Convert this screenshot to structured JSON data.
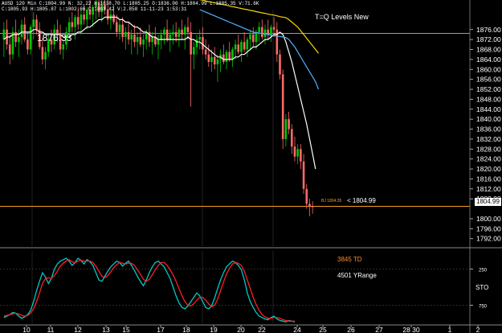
{
  "header": {
    "info_line_1": "AUSD 120 Min  C:1804.99  N:  32.22 H:1838.70  L:1805.25  O:1836.00  H:1804.99  L:1805.35  V:71.6K",
    "info_line_2": "C:1805.93  H:1805.87  L:1802.66  C:1803.42  V:2.858  11-11-23  1:53:31"
  },
  "labels": {
    "study_title": "T=Q Levels New",
    "price_annotation": "1876.33",
    "current_price_marker": "< 1804.99",
    "current_price_tag": "BJ 1804.35",
    "price_axis_box": "1804.99",
    "td_label": "3845 TD",
    "yrange_label": "4501 YRange",
    "sto_label": "STO"
  },
  "colors": {
    "background": "#000000",
    "grid": "#3a3a3a",
    "candle_up": "#00c800",
    "candle_down": "#ff6a6a",
    "ma_white": "#ffffff",
    "ma_blue": "#4fb2ff",
    "ma_yellow": "#f5d800",
    "level_orange": "#f0a020",
    "sto_k": "#00c8c8",
    "sto_d": "#ff2020",
    "td_label": "#ff8c28"
  },
  "chart_data": [
    {
      "type": "candlestick",
      "instrument": "AUSD",
      "y_axis": {
        "ticks": [
          1876,
          1872,
          1868,
          1864,
          1860,
          1856,
          1852,
          1848,
          1844,
          1840,
          1836,
          1832,
          1828,
          1824,
          1820,
          1816,
          1812,
          1808,
          1800,
          1796,
          1792
        ],
        "ylim": [
          1789,
          1884
        ]
      },
      "x_axis": {
        "tick_labels": [
          "10",
          "11",
          "12",
          "13",
          "15",
          "17",
          "18",
          "19",
          "20",
          "22",
          "24",
          "25",
          "26",
          "27",
          "28 30",
          "1",
          "2"
        ]
      },
      "horizontal_levels": [
        1874.5,
        1804.99
      ],
      "ohlc": [
        [
          1872,
          1879,
          1865,
          1876
        ],
        [
          1876,
          1880,
          1868,
          1870
        ],
        [
          1870,
          1874,
          1862,
          1866
        ],
        [
          1866,
          1877,
          1864,
          1875
        ],
        [
          1875,
          1880,
          1869,
          1871
        ],
        [
          1871,
          1876,
          1865,
          1873
        ],
        [
          1873,
          1880,
          1870,
          1878
        ],
        [
          1878,
          1881,
          1871,
          1872
        ],
        [
          1872,
          1875,
          1866,
          1868
        ],
        [
          1868,
          1878,
          1866,
          1877
        ],
        [
          1877,
          1883,
          1872,
          1880
        ],
        [
          1880,
          1882,
          1874,
          1876
        ],
        [
          1876,
          1879,
          1868,
          1869
        ],
        [
          1869,
          1873,
          1862,
          1864
        ],
        [
          1864,
          1869,
          1860,
          1867
        ],
        [
          1867,
          1874,
          1865,
          1872
        ],
        [
          1872,
          1876,
          1867,
          1870
        ],
        [
          1870,
          1878,
          1868,
          1876
        ],
        [
          1876,
          1880,
          1871,
          1874
        ],
        [
          1874,
          1878,
          1866,
          1868
        ],
        [
          1868,
          1872,
          1864,
          1870
        ],
        [
          1870,
          1877,
          1868,
          1875
        ],
        [
          1875,
          1881,
          1872,
          1879
        ],
        [
          1879,
          1883,
          1875,
          1877
        ],
        [
          1877,
          1882,
          1872,
          1881
        ],
        [
          1881,
          1885,
          1876,
          1878
        ],
        [
          1878,
          1884,
          1874,
          1882
        ],
        [
          1882,
          1886,
          1878,
          1880
        ],
        [
          1880,
          1885,
          1876,
          1884
        ],
        [
          1884,
          1888,
          1880,
          1882
        ],
        [
          1882,
          1886,
          1877,
          1885
        ],
        [
          1885,
          1890,
          1880,
          1887
        ],
        [
          1887,
          1890,
          1881,
          1883
        ],
        [
          1883,
          1888,
          1879,
          1886
        ],
        [
          1886,
          1890,
          1882,
          1884
        ],
        [
          1884,
          1888,
          1878,
          1880
        ],
        [
          1880,
          1884,
          1876,
          1882
        ],
        [
          1882,
          1886,
          1878,
          1879
        ],
        [
          1879,
          1882,
          1873,
          1875
        ],
        [
          1875,
          1880,
          1872,
          1878
        ],
        [
          1878,
          1881,
          1871,
          1873
        ],
        [
          1873,
          1877,
          1868,
          1875
        ],
        [
          1875,
          1879,
          1870,
          1872
        ],
        [
          1872,
          1876,
          1866,
          1874
        ],
        [
          1874,
          1878,
          1869,
          1871
        ],
        [
          1871,
          1875,
          1866,
          1873
        ],
        [
          1873,
          1877,
          1869,
          1870
        ],
        [
          1870,
          1874,
          1865,
          1872
        ],
        [
          1872,
          1876,
          1868,
          1875
        ],
        [
          1875,
          1878,
          1869,
          1871
        ],
        [
          1871,
          1875,
          1866,
          1873
        ],
        [
          1873,
          1877,
          1869,
          1870
        ],
        [
          1870,
          1874,
          1864,
          1872
        ],
        [
          1872,
          1876,
          1868,
          1874
        ],
        [
          1874,
          1877,
          1870,
          1876
        ],
        [
          1876,
          1880,
          1871,
          1872
        ],
        [
          1872,
          1876,
          1867,
          1874
        ],
        [
          1874,
          1878,
          1870,
          1875
        ],
        [
          1875,
          1879,
          1871,
          1873
        ],
        [
          1873,
          1877,
          1869,
          1876
        ],
        [
          1876,
          1880,
          1872,
          1874
        ],
        [
          1874,
          1878,
          1868,
          1877
        ],
        [
          1877,
          1881,
          1872,
          1875
        ],
        [
          1875,
          1879,
          1845,
          1866
        ],
        [
          1866,
          1871,
          1860,
          1869
        ],
        [
          1869,
          1874,
          1866,
          1872
        ],
        [
          1872,
          1876,
          1868,
          1873
        ],
        [
          1873,
          1877,
          1866,
          1868
        ],
        [
          1868,
          1872,
          1864,
          1866
        ],
        [
          1866,
          1870,
          1861,
          1863
        ],
        [
          1863,
          1868,
          1859,
          1865
        ],
        [
          1865,
          1869,
          1860,
          1862
        ],
        [
          1862,
          1866,
          1855,
          1864
        ],
        [
          1864,
          1868,
          1859,
          1866
        ],
        [
          1866,
          1870,
          1862,
          1863
        ],
        [
          1863,
          1868,
          1860,
          1867
        ],
        [
          1867,
          1871,
          1863,
          1864
        ],
        [
          1864,
          1869,
          1861,
          1868
        ],
        [
          1868,
          1872,
          1864,
          1870
        ],
        [
          1870,
          1874,
          1866,
          1867
        ],
        [
          1867,
          1872,
          1863,
          1871
        ],
        [
          1871,
          1875,
          1867,
          1868
        ],
        [
          1868,
          1873,
          1865,
          1872
        ],
        [
          1872,
          1876,
          1868,
          1874
        ],
        [
          1874,
          1877,
          1869,
          1871
        ],
        [
          1871,
          1876,
          1868,
          1875
        ],
        [
          1875,
          1879,
          1871,
          1877
        ],
        [
          1877,
          1880,
          1872,
          1873
        ],
        [
          1873,
          1878,
          1870,
          1876
        ],
        [
          1876,
          1880,
          1872,
          1874
        ],
        [
          1874,
          1878,
          1871,
          1877
        ],
        [
          1877,
          1881,
          1873,
          1876
        ],
        [
          1876,
          1879,
          1863,
          1866
        ],
        [
          1866,
          1868,
          1856,
          1858
        ],
        [
          1858,
          1860,
          1828,
          1832
        ],
        [
          1832,
          1842,
          1829,
          1840
        ],
        [
          1840,
          1843,
          1834,
          1836
        ],
        [
          1836,
          1838,
          1826,
          1829
        ],
        [
          1829,
          1833,
          1823,
          1825
        ],
        [
          1825,
          1830,
          1822,
          1828
        ],
        [
          1828,
          1830,
          1820,
          1823
        ],
        [
          1823,
          1826,
          1810,
          1812
        ],
        [
          1812,
          1814,
          1804,
          1806
        ],
        [
          1806,
          1808,
          1801,
          1805
        ],
        [
          1805,
          1807,
          1802,
          1804.99
        ]
      ],
      "moving_averages": [
        {
          "color": "white",
          "values": [
            1872,
            1873,
            1873,
            1874,
            1874,
            1874,
            1875,
            1875,
            1875,
            1875,
            1876,
            1876,
            1875,
            1875,
            1874,
            1874,
            1874,
            1874,
            1874,
            1874,
            1873,
            1873,
            1873,
            1874,
            1874,
            1875,
            1875,
            1876,
            1877,
            1877,
            1878,
            1879,
            1880,
            1880,
            1881,
            1881,
            1881,
            1881,
            1881,
            1880,
            1880,
            1879,
            1879,
            1878,
            1877,
            1877,
            1876,
            1875,
            1875,
            1874,
            1873,
            1873,
            1872,
            1872,
            1872,
            1872,
            1872,
            1872,
            1872,
            1872,
            1872,
            1872,
            1873,
            1872,
            1872,
            1871,
            1871,
            1870,
            1869,
            1868,
            1867,
            1866,
            1865,
            1865,
            1864,
            1864,
            1864,
            1864,
            1865,
            1865,
            1866,
            1866,
            1867,
            1868,
            1869,
            1869,
            1870,
            1871,
            1872,
            1872,
            1873,
            1874,
            1874,
            1875,
            1874,
            1871,
            1867,
            1863,
            1858,
            1853,
            1848,
            1843,
            1838,
            1832,
            1826,
            1820
          ]
        },
        {
          "color": "blue",
          "start": 66,
          "values": [
            1884,
            1883.5,
            1883,
            1882.5,
            1882,
            1881.5,
            1881,
            1880.5,
            1880,
            1879.5,
            1879,
            1878.5,
            1878,
            1877.5,
            1877,
            1876.5,
            1876,
            1875.5,
            1875,
            1874.8,
            1874.6,
            1874.4,
            1874.2,
            1874,
            1873.8,
            1873.6,
            1873.4,
            1873.2,
            1873,
            1872.8,
            1872,
            1870.5,
            1869,
            1867,
            1865,
            1863,
            1861,
            1859,
            1857,
            1855,
            1852
          ]
        },
        {
          "color": "yellow",
          "start": 66,
          "values": [
            1888,
            1887.8,
            1887.5,
            1887.2,
            1887,
            1886.7,
            1886.5,
            1886.2,
            1886,
            1885.8,
            1885.5,
            1885.2,
            1885,
            1884.7,
            1884.5,
            1884.2,
            1884,
            1883.7,
            1883.5,
            1883.2,
            1883,
            1882.7,
            1882.5,
            1882.2,
            1882,
            1881.8,
            1881.5,
            1881.2,
            1881,
            1880.8,
            1880,
            1879,
            1878,
            1877,
            1875.5,
            1874,
            1872.5,
            1871,
            1869.5,
            1868,
            1866.5
          ]
        }
      ]
    },
    {
      "type": "line",
      "name": "STO",
      "ylim": [
        0,
        100
      ],
      "levels": [
        25,
        75
      ],
      "series": [
        {
          "color": "cyan",
          "values": [
            8,
            10,
            12,
            15,
            14,
            10,
            7,
            9,
            12,
            18,
            30,
            45,
            58,
            70,
            64,
            55,
            62,
            75,
            82,
            86,
            88,
            90,
            86,
            80,
            84,
            90,
            87,
            82,
            88,
            85,
            80,
            70,
            60,
            58,
            65,
            72,
            78,
            82,
            86,
            84,
            79,
            83,
            86,
            80,
            73,
            65,
            58,
            52,
            60,
            70,
            78,
            84,
            86,
            82,
            78,
            70,
            62,
            50,
            38,
            28,
            22,
            20,
            24,
            30,
            36,
            42,
            38,
            30,
            22,
            20,
            24,
            35,
            48,
            60,
            70,
            78,
            82,
            86,
            84,
            80,
            74,
            60,
            42,
            30,
            22,
            15,
            10,
            8,
            6,
            5,
            8,
            10,
            6,
            4,
            3,
            2,
            4,
            3,
            2
          ]
        },
        {
          "color": "red",
          "values": [
            10,
            11,
            12,
            13,
            14,
            13,
            11,
            10,
            11,
            14,
            20,
            30,
            42,
            55,
            62,
            63,
            62,
            66,
            72,
            79,
            83,
            86,
            88,
            85,
            84,
            86,
            87,
            86,
            86,
            86,
            84,
            79,
            72,
            65,
            63,
            66,
            71,
            77,
            81,
            84,
            83,
            82,
            83,
            83,
            80,
            74,
            68,
            61,
            58,
            61,
            67,
            74,
            80,
            84,
            84,
            80,
            74,
            67,
            58,
            48,
            38,
            30,
            25,
            24,
            27,
            32,
            36,
            36,
            32,
            27,
            23,
            25,
            33,
            45,
            57,
            68,
            76,
            82,
            84,
            83,
            80,
            72,
            60,
            48,
            36,
            26,
            18,
            12,
            9,
            7,
            7,
            8,
            8,
            7,
            5,
            4,
            3,
            3,
            3
          ]
        }
      ]
    }
  ]
}
